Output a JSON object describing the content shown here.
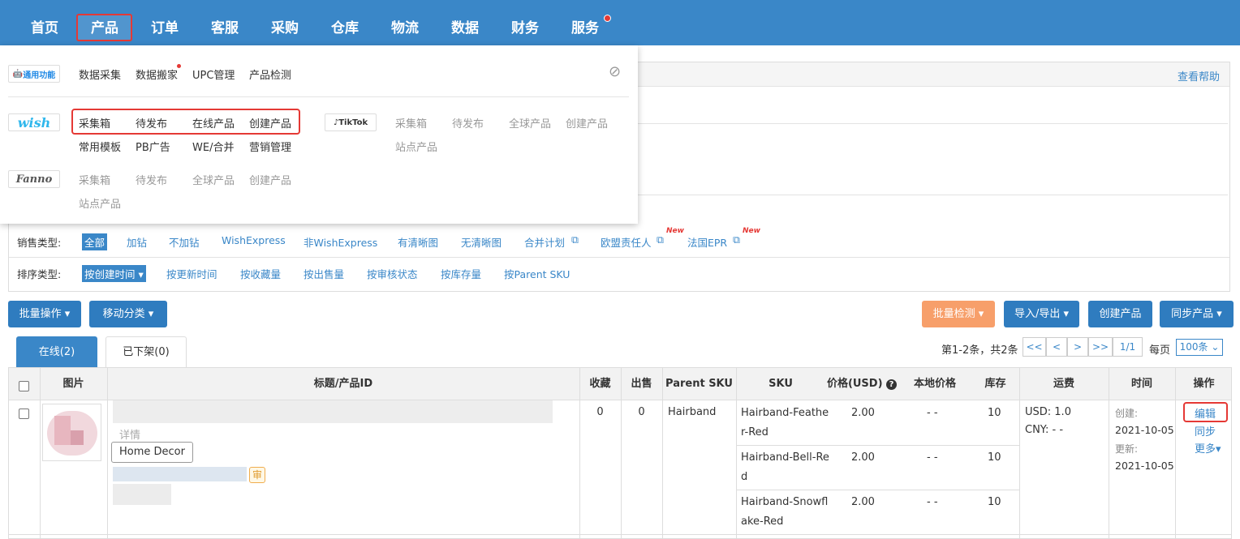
{
  "nav": {
    "items": [
      "首页",
      "产品",
      "订单",
      "客服",
      "采购",
      "仓库",
      "物流",
      "数据",
      "财务",
      "服务"
    ]
  },
  "dropdown": {
    "general": {
      "badge": "通用功能",
      "links": [
        "数据采集",
        "数据搬家",
        "UPC管理",
        "产品检测"
      ]
    },
    "wish": {
      "brand": "wish",
      "row1": [
        "采集箱",
        "待发布",
        "在线产品",
        "创建产品"
      ],
      "row2": [
        "常用模板",
        "PB广告",
        "WE/合并",
        "营销管理"
      ]
    },
    "tiktok": {
      "brand": "TikTok",
      "row1": [
        "采集箱",
        "待发布",
        "全球产品",
        "创建产品"
      ],
      "row2": [
        "站点产品"
      ]
    },
    "fanno": {
      "brand": "Fanno",
      "row1": [
        "采集箱",
        "待发布",
        "全球产品",
        "创建产品"
      ],
      "row2": [
        "站点产品"
      ]
    }
  },
  "panel": {
    "help": "查看帮助"
  },
  "filters": {
    "sale_label": "销售类型:",
    "sale_options": [
      "全部",
      "加钻",
      "不加钻",
      "WishExpress",
      "非WishExpress",
      "有清晰图",
      "无清晰图",
      "合并计划",
      "欧盟责任人",
      "法国EPR"
    ],
    "new_badge": "New",
    "sort_label": "排序类型:",
    "sort_options": [
      "按创建时间",
      "按更新时间",
      "按收藏量",
      "按出售量",
      "按审核状态",
      "按库存量",
      "按Parent SKU"
    ]
  },
  "toolbar": {
    "bulk": "批量操作",
    "move": "移动分类",
    "check": "批量检测",
    "io": "导入/导出",
    "create": "创建产品",
    "sync": "同步产品"
  },
  "tabs": {
    "online": "在线(2)",
    "offline": "已下架(0)"
  },
  "pagination": {
    "summary": "第1-2条，共2条",
    "first": "<<",
    "prev": "<",
    "next": ">",
    "last": ">>",
    "page": "1/1",
    "per_label": "每页",
    "per_value": "100条"
  },
  "table": {
    "headers": [
      "图片",
      "标题/产品ID",
      "收藏",
      "出售",
      "Parent SKU",
      "SKU",
      "价格(USD)",
      "本地价格",
      "库存",
      "运费",
      "时间",
      "操作"
    ],
    "row": {
      "details": "详情",
      "tag": "Home Decor",
      "audit": "审",
      "fav": "0",
      "sold": "0",
      "parent_sku": "Hairband",
      "variants": [
        {
          "sku1": "Hairband-Feathe",
          "sku2": "r-Red",
          "price": "2.00",
          "local": "- -",
          "stock": "10"
        },
        {
          "sku1": "Hairband-Bell-Re",
          "sku2": "d",
          "price": "2.00",
          "local": "- -",
          "stock": "10"
        },
        {
          "sku1": "Hairband-Snowfl",
          "sku2": "ake-Red",
          "price": "2.00",
          "local": "- -",
          "stock": "10"
        }
      ],
      "ship_usd": "USD:   1.0",
      "ship_cny": "CNY:   - -",
      "created_label": "创建:",
      "created": "2021-10-05",
      "updated_label": "更新:",
      "updated": "2021-10-05",
      "actions": {
        "edit": "编辑",
        "sync": "同步",
        "more": "更多"
      }
    }
  }
}
